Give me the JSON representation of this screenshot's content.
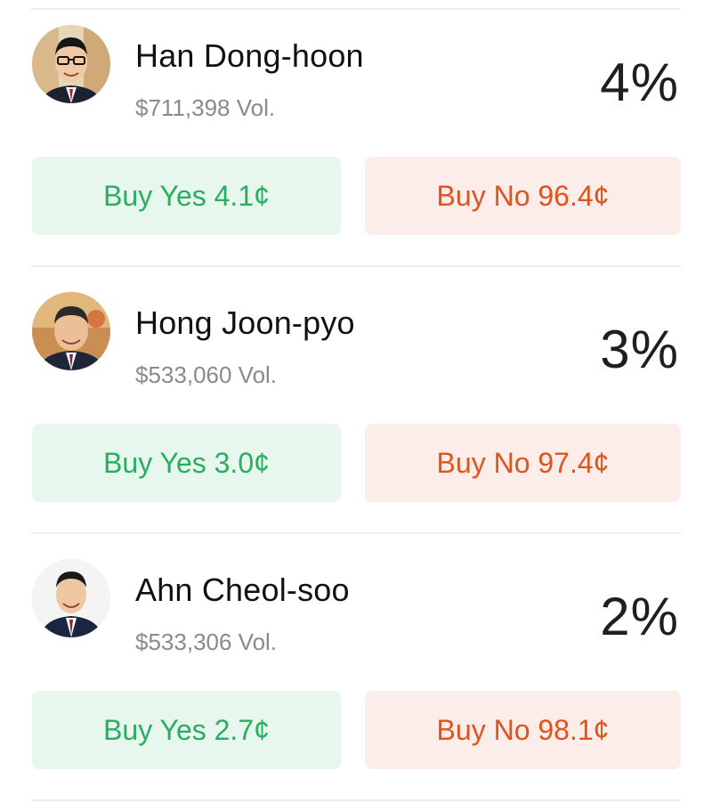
{
  "markets": [
    {
      "name": "Han Dong-hoon",
      "volume": "$711,398 Vol.",
      "percent": "4%",
      "yes_label": "Buy Yes 4.1¢",
      "no_label": "Buy No 96.4¢"
    },
    {
      "name": "Hong Joon-pyo",
      "volume": "$533,060 Vol.",
      "percent": "3%",
      "yes_label": "Buy Yes 3.0¢",
      "no_label": "Buy No 97.4¢"
    },
    {
      "name": "Ahn Cheol-soo",
      "volume": "$533,306 Vol.",
      "percent": "2%",
      "yes_label": "Buy Yes 2.7¢",
      "no_label": "Buy No 98.1¢"
    }
  ],
  "colors": {
    "yes_text": "#27ae60",
    "yes_bg": "#e8f7ee",
    "no_text": "#e0531c",
    "no_bg": "#fcecea"
  }
}
